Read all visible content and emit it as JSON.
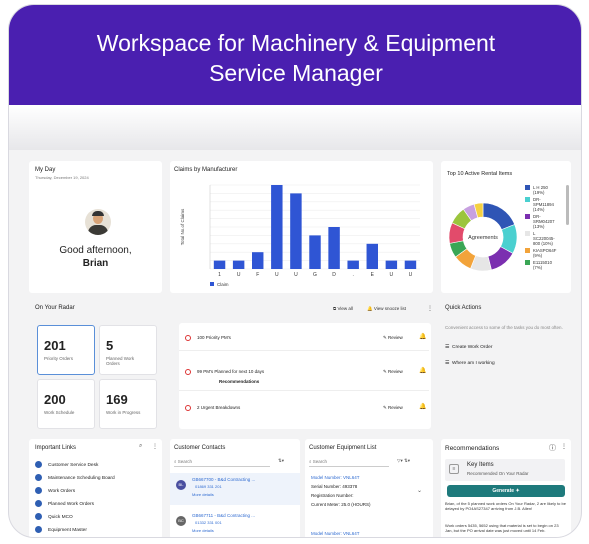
{
  "banner": {
    "title_line1": "Workspace for Machinery & Equipment",
    "title_line2": "Service Manager"
  },
  "myday": {
    "title": "My Day",
    "date": "Thursday, December 19, 2024",
    "greeting": "Good afternoon,",
    "name": "Brian"
  },
  "claims": {
    "title": "Claims by Manufacturer",
    "ylabel": "Total No.of Claims",
    "legend": "Claim"
  },
  "chart_data": [
    {
      "type": "bar",
      "title": "Claims by Manufacturer",
      "ylabel": "Total No.of Claims",
      "categories": [
        "1",
        "U",
        "F",
        "U",
        "U",
        "G",
        "D",
        ".",
        "E",
        "U",
        "U"
      ],
      "series": [
        {
          "name": "Claim",
          "values": [
            1,
            1,
            2,
            10,
            9,
            4,
            5,
            1,
            3,
            1,
            1
          ]
        }
      ],
      "ylim": [
        0,
        10
      ]
    },
    {
      "type": "pie",
      "title": "Top 10 Active Rental Items",
      "center_label": "Agreements",
      "categories": [
        "L H 250 (19%)",
        "DR-SPM11894 (14%)",
        "DR-SRM04207 (13%)",
        "L SC220045-800 (10%)",
        "KIASPO64F (9%)",
        "E1115010 (7%)"
      ],
      "values": [
        19,
        14,
        13,
        10,
        9,
        7
      ]
    }
  ],
  "rental": {
    "title": "Top 10 Active Rental Items",
    "center": "Agreements",
    "legend": [
      {
        "lines": [
          "L H 250",
          "(19%)"
        ],
        "color": "#2f55b5"
      },
      {
        "lines": [
          "DR-",
          "SPM11894",
          "(14%)"
        ],
        "color": "#4ad0d0"
      },
      {
        "lines": [
          "DR-",
          "SRM04207",
          "(13%)"
        ],
        "color": "#7b2fb0"
      },
      {
        "lines": [
          "L",
          "SC220045-",
          "800 (10%)"
        ],
        "color": "#e6e6e6"
      },
      {
        "lines": [
          "KIASPO64F",
          "(9%)"
        ],
        "color": "#f2a33a"
      },
      {
        "lines": [
          "E1115010",
          "(7%)"
        ],
        "color": "#3aa655"
      }
    ]
  },
  "radar": {
    "title": "On Your Radar",
    "view_all": "View all",
    "snooze": "View snooze list",
    "kpis": [
      {
        "num": "201",
        "label": "Priority Orders"
      },
      {
        "num": "5",
        "label": "Planned Work Orders"
      },
      {
        "num": "200",
        "label": "Work Schedule"
      },
      {
        "num": "169",
        "label": "Work in Progress"
      }
    ],
    "items": [
      {
        "label": "100 Priority PM's",
        "review": "Review"
      },
      {
        "label": "99 PM's Planned for next 10 days",
        "sub": "Recommendations",
        "review": "Review"
      },
      {
        "label": "2 Urgent Breakdowns",
        "review": "Review"
      }
    ]
  },
  "quick": {
    "title": "Quick Actions",
    "desc": "Convenient access to some of the tasks you do most often.",
    "actions": [
      "Create Work Order",
      "Where am I working"
    ]
  },
  "links": {
    "title": "Important Links",
    "items": [
      "Customer Service Desk",
      "Maintenance Scheduling Board",
      "Work Orders",
      "Planned Work Orders",
      "Quick MCO",
      "Equipment Master"
    ]
  },
  "contacts": {
    "title": "Customer Contacts",
    "search": "Search",
    "items": [
      {
        "initials": "BL",
        "name": "GB667700 - B&d Contracting ...",
        "phone": "01869 331 201",
        "more": "More details"
      },
      {
        "initials": "BC",
        "name": "GB667711 - B&d Contracting ...",
        "phone": "01332 331 001",
        "more": "More details"
      }
    ]
  },
  "equipment": {
    "title": "Customer Equipment List",
    "search": "Search",
    "model": "Model Number: VNL64T",
    "serial": "Serial Number: 493378",
    "reg": "Registration Number:",
    "meter": "Current Meter: 25.0 (HOURS)",
    "model2": "Model Number: VNL64T"
  },
  "recs": {
    "title": "Recommendations",
    "key": "Key Items",
    "key_sub": "Recommended On Your Radar",
    "generate": "Generate",
    "text1": "Brian, of the 5 planned work orders On Your Radar, 2 are likely to be delayed by PO4AS27347 arriving from J.B. Allen!",
    "text2": "Work orders 5435, 5652 using that material is set to begin on 23 Jan, but the PO arrival date was just moved until 14 Feb."
  }
}
